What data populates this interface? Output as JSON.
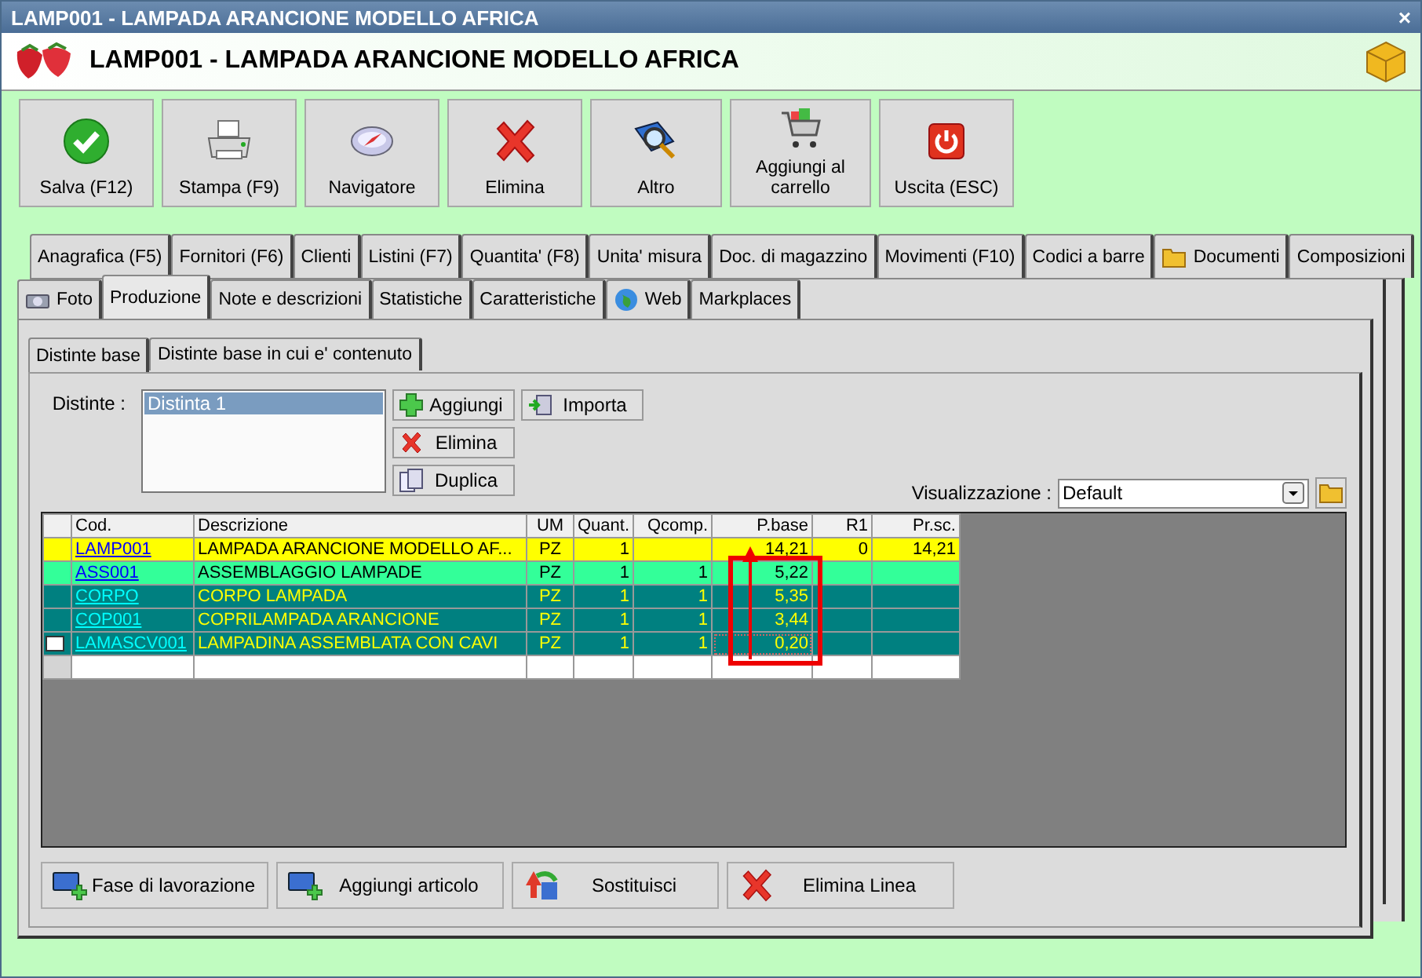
{
  "window": {
    "title": "LAMP001 - LAMPADA ARANCIONE MODELLO AFRICA",
    "close": "×"
  },
  "header": {
    "title": "LAMP001 - LAMPADA ARANCIONE MODELLO AFRICA"
  },
  "toolbar": [
    {
      "label": "Salva (F12)",
      "kind": "check"
    },
    {
      "label": "Stampa (F9)",
      "kind": "printer"
    },
    {
      "label": "Navigatore",
      "kind": "compass"
    },
    {
      "label": "Elimina",
      "kind": "cross"
    },
    {
      "label": "Altro",
      "kind": "magnifier"
    },
    {
      "label": "Aggiungi al carrello",
      "kind": "cart"
    },
    {
      "label": "Uscita (ESC)",
      "kind": "power"
    }
  ],
  "tabs_row_1": [
    {
      "label": "Anagrafica (F5)",
      "kind": "plain",
      "selected": false
    },
    {
      "label": "Fornitori (F6)",
      "kind": "plain",
      "selected": false
    },
    {
      "label": "Clienti",
      "kind": "plain",
      "selected": false
    },
    {
      "label": "Listini (F7)",
      "kind": "plain",
      "selected": false
    },
    {
      "label": "Quantita' (F8)",
      "kind": "plain",
      "selected": false
    },
    {
      "label": "Unita' misura",
      "kind": "plain",
      "selected": false
    },
    {
      "label": "Doc. di magazzino",
      "kind": "plain",
      "selected": false
    },
    {
      "label": "Movimenti (F10)",
      "kind": "plain",
      "selected": false
    },
    {
      "label": "Codici a barre",
      "kind": "plain",
      "selected": false
    },
    {
      "label": "Documenti",
      "kind": "folder",
      "selected": false
    },
    {
      "label": "Composizioni",
      "kind": "plain",
      "selected": false
    }
  ],
  "tabs_row_2": [
    {
      "label": "Foto",
      "kind": "camera",
      "selected": false
    },
    {
      "label": "Produzione",
      "kind": "plain",
      "selected": true
    },
    {
      "label": "Note e descrizioni",
      "kind": "plain",
      "selected": false
    },
    {
      "label": "Statistiche",
      "kind": "plain",
      "selected": false
    },
    {
      "label": "Caratteristiche",
      "kind": "plain",
      "selected": false
    },
    {
      "label": "Web",
      "kind": "globe",
      "selected": false
    },
    {
      "label": "Markplaces",
      "kind": "plain",
      "selected": false
    }
  ],
  "subtabs": [
    {
      "label": "Distinte base",
      "selected": true
    },
    {
      "label": "Distinte base in cui e' contenuto",
      "selected": false
    }
  ],
  "distinte": {
    "label": "Distinte :",
    "items": [
      {
        "label": "Distinta 1",
        "selected": true
      }
    ]
  },
  "distinte_buttons": [
    {
      "label": "Aggiungi",
      "kind": "plus"
    },
    {
      "label": "Elimina",
      "kind": "cross"
    },
    {
      "label": "Duplica",
      "kind": "copy"
    },
    {
      "label": "Importa",
      "kind": "import"
    }
  ],
  "view": {
    "label": "Visualizzazione :",
    "value": "Default"
  },
  "table": {
    "columns": [
      "Cod.",
      "Descrizione",
      "UM",
      "Quant.",
      "Qcomp.",
      "P.base",
      "R1",
      "Pr.sc."
    ],
    "rows": [
      {
        "color": "#ffff00",
        "selected": false,
        "cells": [
          "LAMP001",
          "LAMPADA ARANCIONE MODELLO AF...",
          "PZ",
          "1",
          "",
          "14,21",
          "0",
          "14,21"
        ]
      },
      {
        "color": "#33ff99",
        "selected": false,
        "cells": [
          "ASS001",
          "ASSEMBLAGGIO LAMPADE",
          "PZ",
          "1",
          "1",
          "5,22",
          "",
          ""
        ]
      },
      {
        "color": "#008080",
        "selected": false,
        "cells": [
          "CORPO",
          "CORPO LAMPADA",
          "PZ",
          "1",
          "1",
          "5,35",
          "",
          ""
        ]
      },
      {
        "color": "#008080",
        "selected": false,
        "cells": [
          "COP001",
          "COPRILAMPADA ARANCIONE",
          "PZ",
          "1",
          "1",
          "3,44",
          "",
          ""
        ]
      },
      {
        "color": "#008080",
        "selected": true,
        "cells": [
          "LAMASCV001",
          "LAMPADINA ASSEMBLATA CON CAVI",
          "PZ",
          "1",
          "1",
          "0,20",
          "",
          ""
        ]
      }
    ]
  },
  "bottom_buttons": [
    {
      "label": "Fase di lavorazione",
      "kind": "monitor-plus"
    },
    {
      "label": "Aggiungi articolo",
      "kind": "monitor-plus"
    },
    {
      "label": "Sostituisci",
      "kind": "swap"
    },
    {
      "label": "Elimina Linea",
      "kind": "cross"
    }
  ]
}
